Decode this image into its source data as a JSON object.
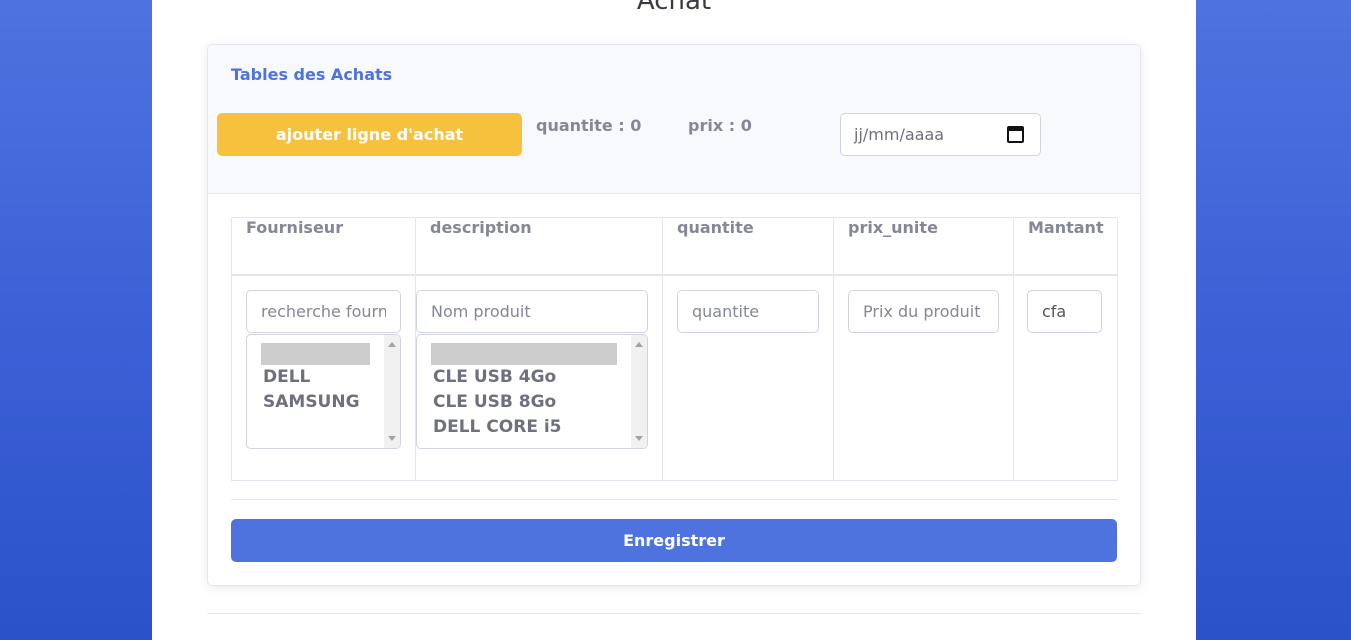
{
  "page": {
    "title": "Achat"
  },
  "card": {
    "title": "Tables des Achats",
    "add_button": "ajouter ligne d'achat",
    "quantity_summary": "quantite : 0",
    "price_summary": "prix : 0",
    "date_placeholder": "jj/mm/aaaa"
  },
  "table": {
    "headers": [
      "Fourniseur",
      "description",
      "quantite",
      "prix_unite",
      "Mantant"
    ],
    "supplier_search_placeholder": "recherche fournisseur",
    "supplier_options": [
      "DELL",
      "SAMSUNG"
    ],
    "product_search_placeholder": "Nom produit",
    "product_options": [
      "CLE USB 4Go",
      "CLE USB 8Go",
      "DELL CORE i5"
    ],
    "quantity_placeholder": "quantite",
    "price_placeholder": "Prix du produit",
    "amount_value": "cfa"
  },
  "save_button": "Enregistrer",
  "colors": {
    "primary": "#4e73df",
    "warning": "#f6c23e",
    "text_muted": "#858796"
  }
}
